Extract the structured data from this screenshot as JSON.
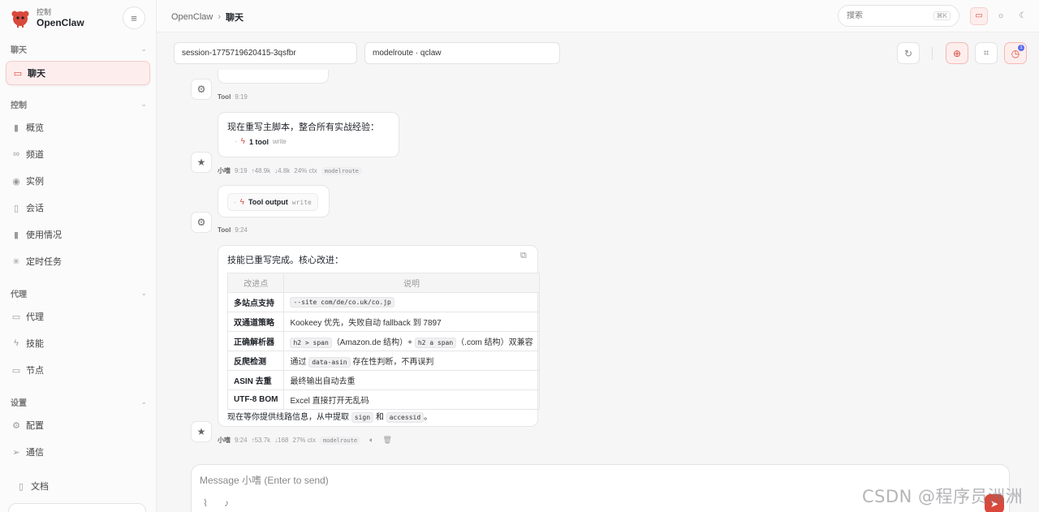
{
  "brand": {
    "subtitle": "控制",
    "name": "OpenClaw"
  },
  "sidebar": {
    "chat_group": "聊天",
    "chat_item": "聊天",
    "control_group": "控制",
    "control_items": [
      "概览",
      "频道",
      "实例",
      "会话",
      "使用情况",
      "定时任务"
    ],
    "agent_group": "代理",
    "agent_items": [
      "代理",
      "技能",
      "节点"
    ],
    "settings_group": "设置",
    "settings_items": [
      "配置",
      "通信"
    ],
    "docs": "文档"
  },
  "topbar": {
    "breadcrumb_root": "OpenClaw",
    "breadcrumb_sep": "›",
    "breadcrumb_current": "聊天",
    "search_placeholder": "搜索",
    "search_shortcut": "⌘K"
  },
  "session": {
    "id": "session-1775719620415-3qsfbr",
    "model": "modelroute · qclaw",
    "badge_count": "1"
  },
  "messages": {
    "tool1": {
      "author": "Tool",
      "time": "9:19"
    },
    "ai1": {
      "text": "现在重写主脚本，整合所有实战经验：",
      "tool_count": "1 tool",
      "tool_name": "write",
      "author": "小嗜",
      "time": "9:19",
      "tokens_in": "↑48.9k",
      "tokens_out": "↓4.8k",
      "ctx": "24% ctx",
      "model": "modelroute"
    },
    "tool2": {
      "output_label": "Tool output",
      "tool_name": "write",
      "author": "Tool",
      "time": "9:24"
    },
    "ai2": {
      "intro": "技能已重写完成。核心改进：",
      "table": {
        "headers": [
          "改进点",
          "说明"
        ],
        "rows": [
          {
            "k": "多站点支持",
            "code1": "--site com/de/co.uk/co.jp"
          },
          {
            "k": "双通道策略",
            "text": "Kookeey 优先，失败自动 fallback 到 7897"
          },
          {
            "k": "正确解析器",
            "code1": "h2 > span",
            "mid": "（Amazon.de 结构）+",
            "code2": "h2 a span",
            "tail": "（.com 结构）双兼容"
          },
          {
            "k": "反爬检测",
            "pre": "通过",
            "code1": "data-asin",
            "tail": "存在性判断，不再误判"
          },
          {
            "k": "ASIN 去重",
            "text": "最终输出自动去重"
          },
          {
            "k": "UTF-8 BOM",
            "text": "Excel 直接打开无乱码"
          }
        ]
      },
      "outro_pre": "现在等你提供线路信息，从中提取",
      "outro_code1": "sign",
      "outro_and": "和",
      "outro_code2": "accessid",
      "outro_end": "。",
      "author": "小嗜",
      "time": "9:24",
      "tokens_in": "↑53.7k",
      "tokens_out": "↓168",
      "ctx": "27% ctx",
      "model": "modelroute"
    }
  },
  "composer": {
    "placeholder": "Message 小嗜 (Enter to send)"
  },
  "watermark": "CSDN @程序员洲洲",
  "colors": {
    "accent": "#d9483b",
    "accent_bg": "#fdeeed",
    "border": "#e6e6e8"
  }
}
